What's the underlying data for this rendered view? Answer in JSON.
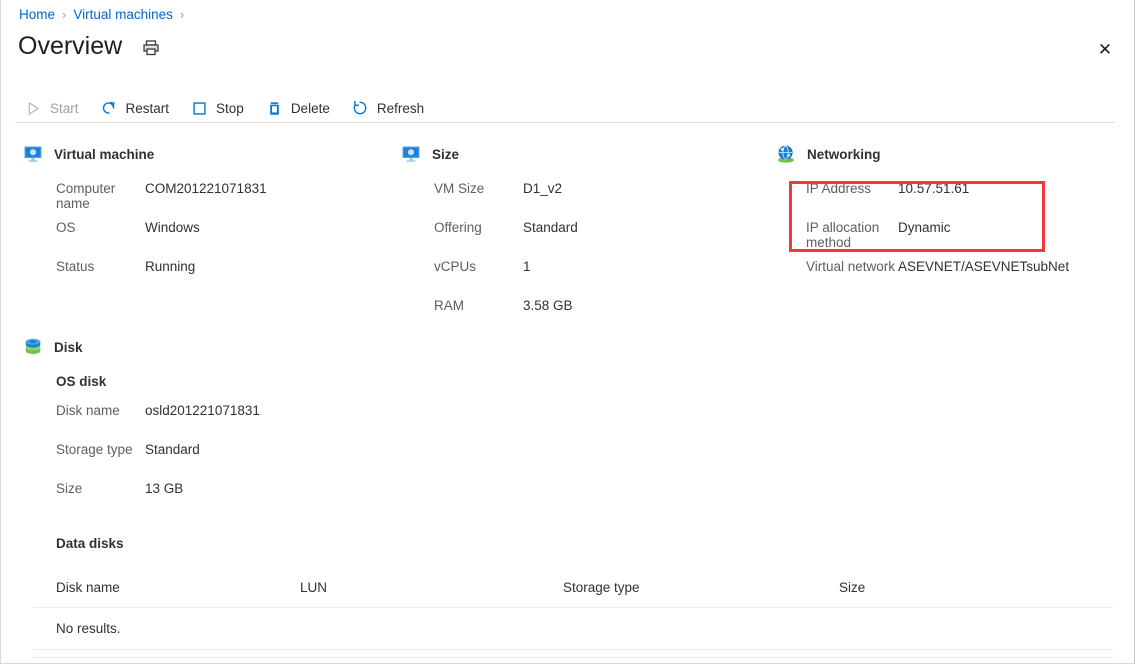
{
  "breadcrumb": {
    "items": [
      "Home",
      "Virtual machines"
    ],
    "separator": "›",
    "trailing_separator": "›"
  },
  "header": {
    "title": "Overview",
    "print_icon": "printer-icon",
    "close_icon": "close-icon",
    "close_glyph": "✕"
  },
  "toolbar": {
    "items": [
      {
        "label": "Start",
        "icon": "play-icon",
        "disabled": true
      },
      {
        "label": "Restart",
        "icon": "restart-icon",
        "disabled": false
      },
      {
        "label": "Stop",
        "icon": "stop-icon",
        "disabled": false
      },
      {
        "label": "Delete",
        "icon": "trash-icon",
        "disabled": false
      },
      {
        "label": "Refresh",
        "icon": "refresh-icon",
        "disabled": false
      }
    ]
  },
  "sections": {
    "virtual_machine": {
      "title": "Virtual machine",
      "icon": "vm-monitor-icon",
      "rows": [
        {
          "key": "Computer name",
          "value": "COM201221071831"
        },
        {
          "key": "OS",
          "value": "Windows"
        },
        {
          "key": "Status",
          "value": "Running"
        }
      ]
    },
    "size": {
      "title": "Size",
      "icon": "vm-monitor-icon",
      "rows": [
        {
          "key": "VM Size",
          "value": "D1_v2"
        },
        {
          "key": "Offering",
          "value": "Standard"
        },
        {
          "key": "vCPUs",
          "value": "1"
        },
        {
          "key": "RAM",
          "value": "3.58 GB"
        }
      ]
    },
    "networking": {
      "title": "Networking",
      "icon": "network-globe-icon",
      "rows": [
        {
          "key": "IP Address",
          "value": "10.57.51.61"
        },
        {
          "key": "IP allocation method",
          "value": "Dynamic"
        },
        {
          "key": "Virtual network",
          "value": "ASEVNET/ASEVNETsubNet"
        }
      ]
    },
    "disk": {
      "title": "Disk",
      "icon": "disk-stack-icon",
      "os_disk_title": "OS disk",
      "os_disk_rows": [
        {
          "key": "Disk name",
          "value": "osld201221071831"
        },
        {
          "key": "Storage type",
          "value": "Standard"
        },
        {
          "key": "Size",
          "value": "13 GB"
        }
      ],
      "data_disks_title": "Data disks",
      "data_disks_table": {
        "columns": [
          "Disk name",
          "LUN",
          "Storage type",
          "Size"
        ],
        "rows": [],
        "empty_text": "No results."
      }
    }
  },
  "annotation": {
    "highlight_color": "#f4373f",
    "highlight_target": "ip-address-and-allocation-method"
  }
}
